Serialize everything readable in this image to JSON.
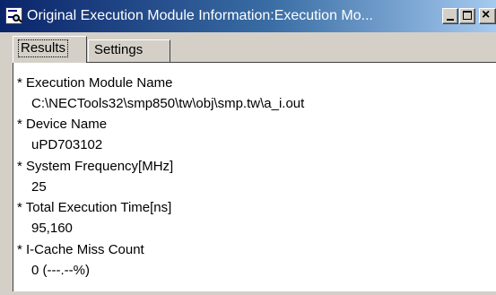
{
  "window": {
    "title": "Original Execution Module Information:Execution Mo..."
  },
  "tabs": [
    {
      "label": "Results",
      "active": true
    },
    {
      "label": "Settings",
      "active": false
    }
  ],
  "results": [
    {
      "heading": "* Execution Module Name",
      "value": "C:\\NECTools32\\smp850\\tw\\obj\\smp.tw\\a_i.out"
    },
    {
      "heading": "* Device Name",
      "value": "uPD703102"
    },
    {
      "heading": "* System Frequency[MHz]",
      "value": "25"
    },
    {
      "heading": "* Total Execution Time[ns]",
      "value": "95,160"
    },
    {
      "heading": "* I-Cache Miss Count",
      "value": "0 (---.--%)"
    }
  ],
  "colors": {
    "titlebar_start": "#0a246a",
    "titlebar_end": "#a6caf0",
    "face": "#d4d0c8"
  }
}
